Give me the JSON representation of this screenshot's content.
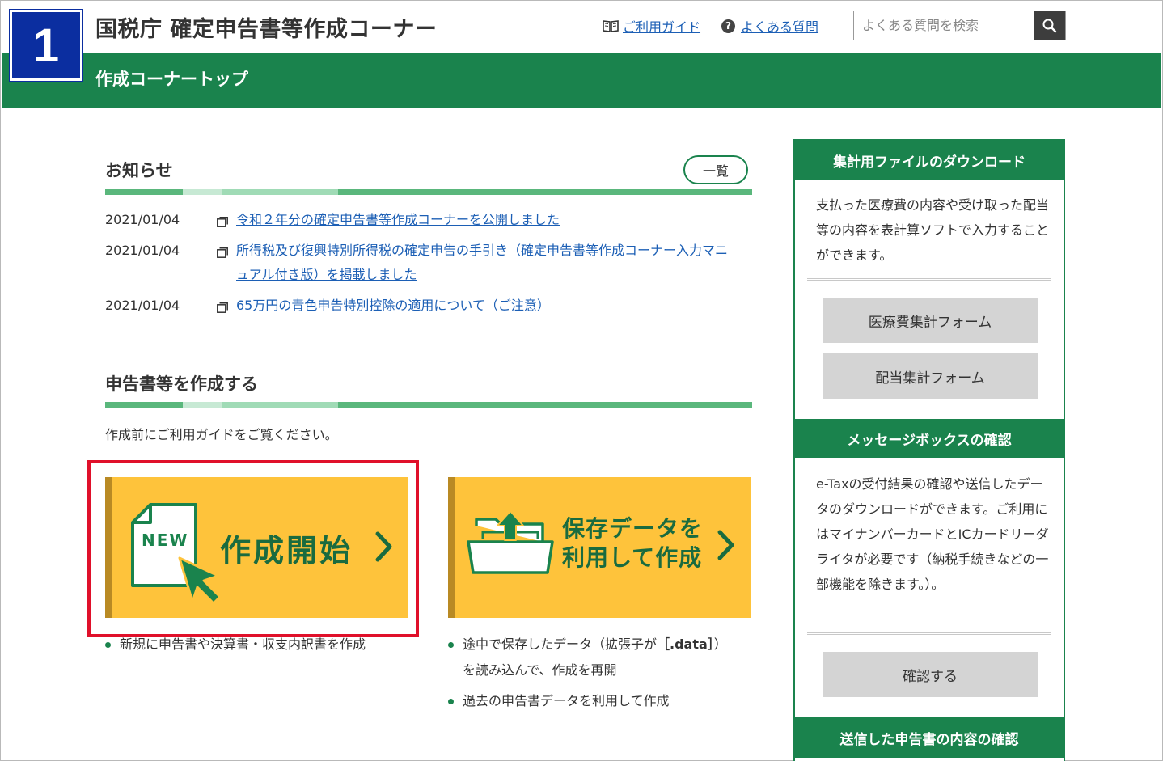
{
  "header": {
    "step_number": "1",
    "site_title": "国税庁 確定申告書等作成コーナー",
    "guide_link": "ご利用ガイド",
    "faq_link": "よくある質問",
    "search_placeholder": "よくある質問を検索",
    "band_title": "作成コーナートップ"
  },
  "news": {
    "title": "お知らせ",
    "list_button": "一覧",
    "items": [
      {
        "date": "2021/01/04",
        "text": "令和２年分の確定申告書等作成コーナーを公開しました"
      },
      {
        "date": "2021/01/04",
        "text": "所得税及び復興特別所得税の確定申告の手引き（確定申告書等作成コーナー入力マニュアル付き版）を掲載しました"
      },
      {
        "date": "2021/01/04",
        "text": "65万円の青色申告特別控除の適用について（ご注意）"
      }
    ]
  },
  "create": {
    "title": "申告書等を作成する",
    "intro": "作成前にご利用ガイドをご覧ください。",
    "start_button": {
      "badge": "NEW",
      "label": "作成開始",
      "bullets": [
        "新規に申告書や決算書・収支内訳書を作成"
      ]
    },
    "resume_button": {
      "label_line1": "保存データを",
      "label_line2": "利用して作成",
      "bullet1_pre": "途中で保存したデータ（拡張子が",
      "bullet1_ext": "［.data］",
      "bullet1_post": "）",
      "bullet1_line2": "を読み込んで、作成を再開",
      "bullet2": "過去の申告書データを利用して作成"
    }
  },
  "sidebar": {
    "download": {
      "heading": "集計用ファイルのダウンロード",
      "text": "支払った医療費の内容や受け取った配当等の内容を表計算ソフトで入力することができます。",
      "buttons": [
        "医療費集計フォーム",
        "配当集計フォーム"
      ]
    },
    "messagebox": {
      "heading": "メッセージボックスの確認",
      "text": "e-Taxの受付結果の確認や送信したデータのダウンロードができます。ご利用にはマイナンバーカードとICカードリーダライタが必要です（納税手続きなどの一部機能を除きます。）。",
      "button": "確認する"
    },
    "sent": {
      "heading": "送信した申告書の内容の確認"
    }
  },
  "colors": {
    "brand_green": "#1a834d",
    "step_blue": "#0b2ea0",
    "button_yellow": "#fec33b",
    "highlight_red": "#e0102a",
    "link_blue": "#1c5fb5"
  }
}
